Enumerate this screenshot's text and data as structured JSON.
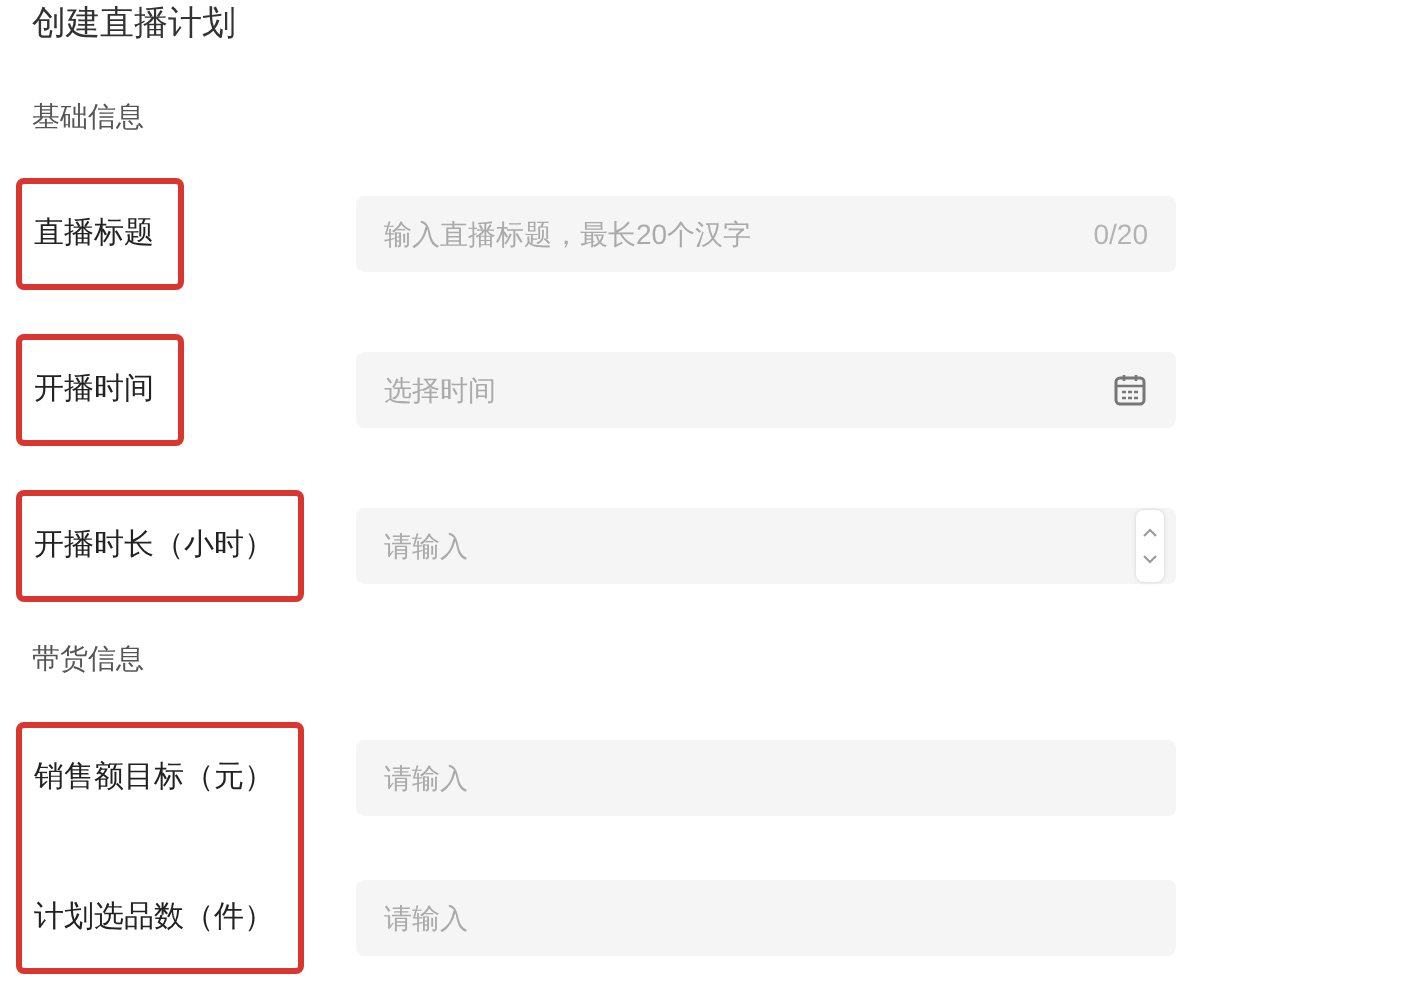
{
  "title": "创建直播计划",
  "sections": [
    {
      "heading": "基础信息",
      "groups": [
        {
          "highlighted": true,
          "fields": [
            {
              "label": "直播标题",
              "placeholder": "输入直播标题，最长20个汉字",
              "suffix": {
                "kind": "counter",
                "text": "0/20"
              }
            }
          ]
        },
        {
          "highlighted": true,
          "fields": [
            {
              "label": "开播时间",
              "placeholder": "选择时间",
              "suffix": {
                "kind": "calendar"
              }
            }
          ]
        },
        {
          "highlighted": true,
          "fields": [
            {
              "label": "开播时长（小时）",
              "placeholder": "请输入",
              "suffix": {
                "kind": "stepper"
              }
            }
          ]
        }
      ]
    },
    {
      "heading": "带货信息",
      "groups": [
        {
          "highlighted": true,
          "fields": [
            {
              "label": "销售额目标（元）",
              "placeholder": "请输入"
            },
            {
              "label": "计划选品数（件）",
              "placeholder": "请输入"
            }
          ]
        }
      ]
    }
  ]
}
